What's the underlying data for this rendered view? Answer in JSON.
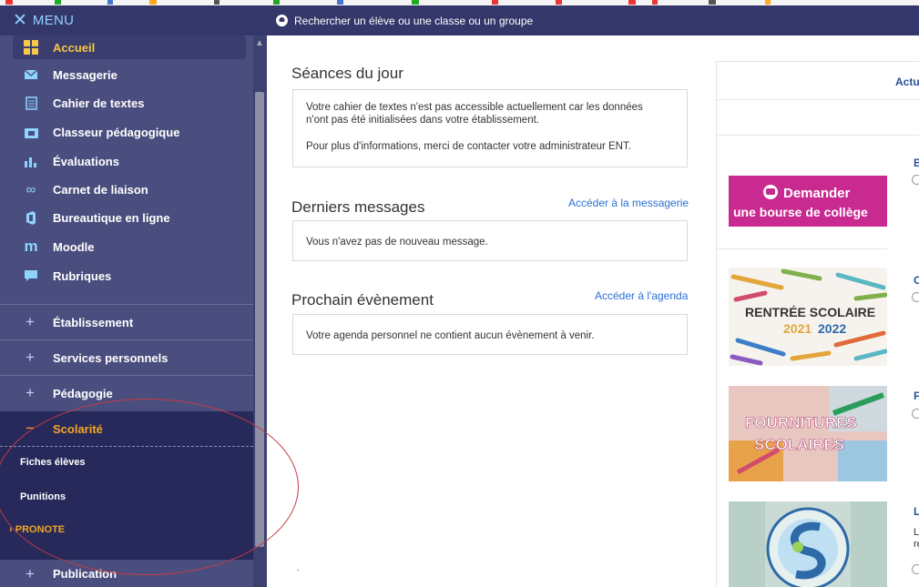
{
  "sidebar": {
    "menu_label": "MENU",
    "items": [
      {
        "label": "Accueil",
        "icon": "grid-icon"
      },
      {
        "label": "Messagerie",
        "icon": "envelope-icon"
      },
      {
        "label": "Cahier de textes",
        "icon": "notebook-icon"
      },
      {
        "label": "Classeur pédagogique",
        "icon": "folder-icon"
      },
      {
        "label": "Évaluations",
        "icon": "bar-chart-icon"
      },
      {
        "label": "Carnet de liaison",
        "icon": "infinity-icon"
      },
      {
        "label": "Bureautique en ligne",
        "icon": "office-icon"
      },
      {
        "label": "Moodle",
        "icon": "moodle-icon"
      },
      {
        "label": "Rubriques",
        "icon": "chat-icon"
      }
    ],
    "sections": [
      {
        "label": "Établissement",
        "sign": "+"
      },
      {
        "label": "Services personnels",
        "sign": "+"
      },
      {
        "label": "Pédagogie",
        "sign": "+"
      },
      {
        "label": "Scolarité",
        "sign": "−"
      }
    ],
    "scolarite_items": [
      "Fiches élèves",
      "Punitions",
      "PRONOTE"
    ],
    "pronote_marker": "›",
    "publication": {
      "label": "Publication",
      "sign": "+"
    }
  },
  "topbar": {
    "search_label": "Rechercher un élève ou une classe ou un groupe"
  },
  "main": {
    "seances": {
      "title": "Séances du jour",
      "line1": "Votre cahier de textes n'est pas accessible actuellement car les données",
      "line2": "n'ont pas été initialisées dans votre établissement.",
      "line3": "Pour plus d'informations, merci de contacter votre administrateur ENT."
    },
    "messages": {
      "title": "Derniers messages",
      "link": "Accéder à la messagerie",
      "text": "Vous n'avez pas de nouveau message."
    },
    "event": {
      "title": "Prochain évènement",
      "link": "Accéder à l'agenda",
      "text": "Votre agenda personnel ne contient aucun évènement à venir."
    }
  },
  "news": {
    "tab": "Actu",
    "bourse": {
      "line1": "Demander",
      "line2": "une bourse de collège"
    },
    "rentree": {
      "line1": "RENTRÉE SCOLAIRE",
      "year1": "2021",
      "year2": "2022"
    },
    "fournitures": {
      "line1": "FOURNITURES",
      "line2": "SCOLAIRES"
    },
    "letters": [
      "B",
      "O",
      "F",
      "L"
    ],
    "fragments": [
      "L",
      "re"
    ]
  },
  "colors": {
    "sidebar": "#4a4e7e",
    "topbar": "#34376a",
    "accent": "#f5a623",
    "link": "#2b6fd6",
    "annotation": "#c23a45"
  }
}
